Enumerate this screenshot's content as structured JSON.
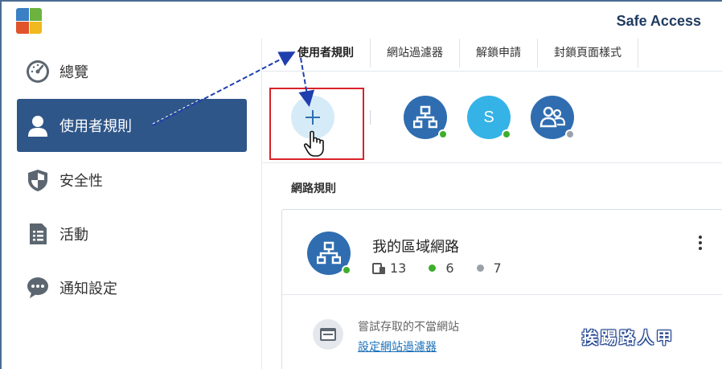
{
  "app": {
    "title": "Safe Access"
  },
  "sidebar": {
    "items": [
      {
        "label": "總覽",
        "icon": "dashboard-gauge-icon"
      },
      {
        "label": "使用者規則",
        "icon": "user-icon",
        "active": true
      },
      {
        "label": "安全性",
        "icon": "shield-icon"
      },
      {
        "label": "活動",
        "icon": "document-list-icon"
      },
      {
        "label": "通知設定",
        "icon": "chat-bubble-icon"
      }
    ]
  },
  "tabs": [
    {
      "label": "使用者規則",
      "active": true
    },
    {
      "label": "網站過濾器"
    },
    {
      "label": "解鎖申請"
    },
    {
      "label": "封鎖頁面樣式"
    }
  ],
  "profiles": {
    "add_icon": "plus-icon",
    "items": [
      {
        "icon": "network-icon",
        "status": "online",
        "color": "#2f6db0"
      },
      {
        "letter": "S",
        "status": "online",
        "color": "#35b3e6"
      },
      {
        "icon": "user-group-icon",
        "status": "offline",
        "color": "#2f6db0"
      }
    ]
  },
  "network_rules": {
    "section_title": "網路規則",
    "card": {
      "name": "我的區域網路",
      "device_count": "13",
      "online_count": "6",
      "offline_count": "7",
      "info_text": "嘗試存取的不當網站",
      "info_link": "設定網站過濾器"
    }
  },
  "colors": {
    "accent": "#2f5689",
    "online": "#3fae2a",
    "offline": "#9aa1a8",
    "highlight": "#d9222a"
  },
  "watermark": "挨踢路人甲"
}
